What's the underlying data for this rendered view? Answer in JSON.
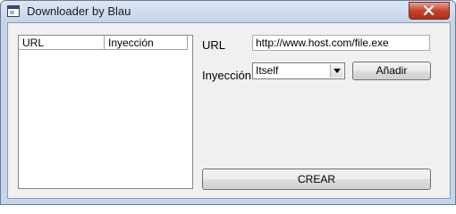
{
  "window": {
    "title": "Downloader by Blau"
  },
  "list": {
    "columns": [
      "URL",
      "Inyección"
    ]
  },
  "form": {
    "url_label": "URL",
    "url_value": "http://www.host.com/file.exe",
    "injection_label": "Inyección",
    "injection_value": "Itself",
    "add_label": "Añadir",
    "create_label": "CREAR"
  },
  "icons": {
    "app": "window-icon",
    "close": "close-icon",
    "dropdown": "chevron-down-icon"
  },
  "colors": {
    "close_button": "#c7432c",
    "titlebar": "#c5d6ea"
  }
}
